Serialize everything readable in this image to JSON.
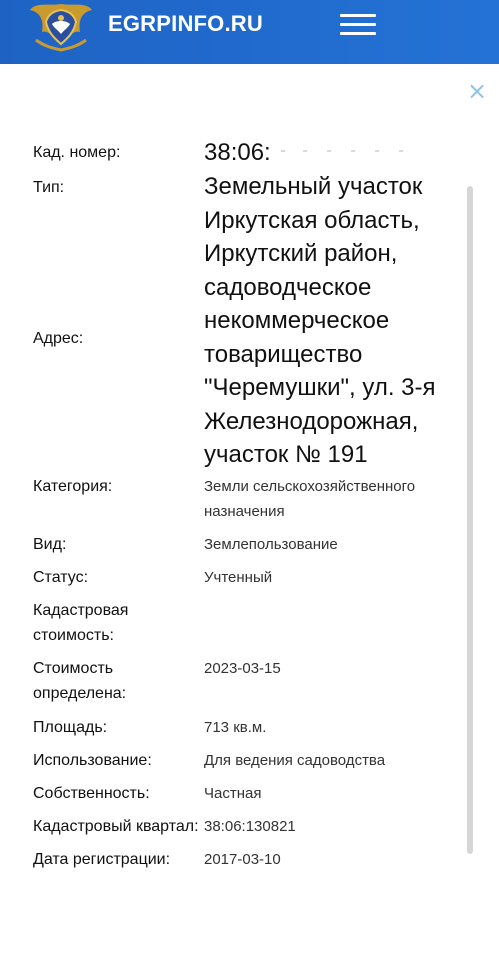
{
  "header": {
    "brand": "EGRPINFO.RU",
    "logo_icon": "eagle-emblem-icon",
    "menu_icon": "hamburger-menu-icon",
    "background": "#1e63c4"
  },
  "dialog": {
    "close_icon": "close-icon",
    "close_glyph": "×",
    "close_color": "#8fc3e8"
  },
  "property": {
    "cad_number": {
      "label": "Кад. номер:",
      "value": "38:06:"
    },
    "type": {
      "label": "Тип:",
      "value_lines": [
        "Земельный участок"
      ]
    },
    "address": {
      "label": "Адрес:",
      "value_lines": [
        "Иркутская область,",
        "Иркутский район,",
        "садоводческое",
        "некоммерческое",
        "товарищество",
        "\"Черемушки\", ул. 3-я",
        "Железнодорожная,",
        "участок № 191"
      ]
    },
    "category": {
      "label": "Категория:",
      "value_lines": [
        "Земли сельскохозяйственного",
        "назначения"
      ]
    },
    "kind": {
      "label": "Вид:",
      "value": "Землепользование"
    },
    "status": {
      "label": "Статус:",
      "value": "Учтенный"
    },
    "cad_cost": {
      "label_lines": [
        "Кадастровая",
        "стоимость:"
      ],
      "value": ""
    },
    "cost_date": {
      "label_lines": [
        "Стоимость",
        "определена:"
      ],
      "value": "2023-03-15"
    },
    "area": {
      "label": "Площадь:",
      "value": "713 кв.м."
    },
    "usage": {
      "label": "Использование:",
      "value": "Для ведения садоводства"
    },
    "ownership": {
      "label": "Собственность:",
      "value": "Частная"
    },
    "cad_quarter": {
      "label": "Кадастровый квартал:",
      "value": "38:06:130821"
    },
    "reg_date": {
      "label": "Дата регистрации:",
      "value": "2017-03-10"
    }
  }
}
